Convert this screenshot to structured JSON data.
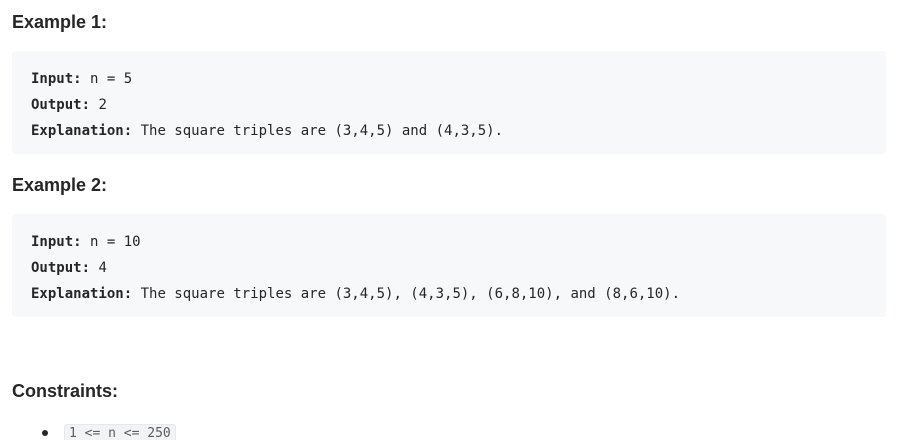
{
  "examples": [
    {
      "title": "Example 1:",
      "input_label": "Input:",
      "input_value": " n = 5",
      "output_label": "Output:",
      "output_value": " 2",
      "explanation_label": "Explanation:",
      "explanation_value": " The square triples are (3,4,5) and (4,3,5)."
    },
    {
      "title": "Example 2:",
      "input_label": "Input:",
      "input_value": " n = 10",
      "output_label": "Output:",
      "output_value": " 4",
      "explanation_label": "Explanation:",
      "explanation_value": " The square triples are (3,4,5), (4,3,5), (6,8,10), and (8,6,10)."
    }
  ],
  "constraints": {
    "title": "Constraints:",
    "items": [
      "1 <= n <= 250"
    ]
  }
}
